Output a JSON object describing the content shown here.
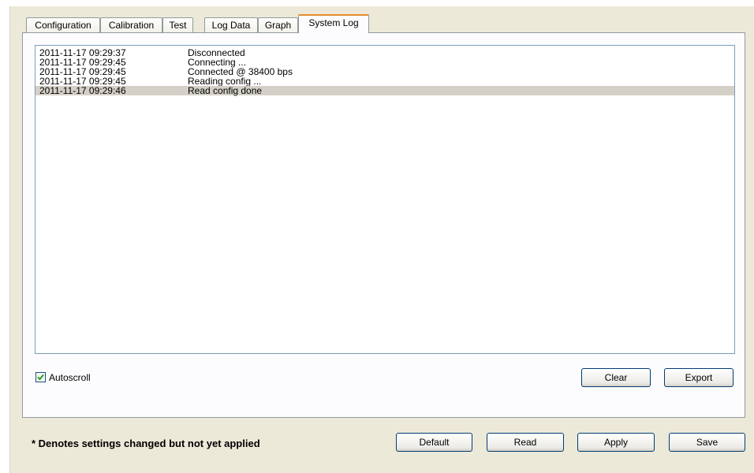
{
  "tabs": [
    {
      "label": "Configuration"
    },
    {
      "label": "Calibration"
    },
    {
      "label": "Test"
    },
    {
      "label": "Log Data"
    },
    {
      "label": "Graph"
    },
    {
      "label": "System Log"
    }
  ],
  "active_tab": "System Log",
  "log": {
    "entries": [
      {
        "time": "2011-11-17 09:29:37",
        "message": "Disconnected"
      },
      {
        "time": "2011-11-17 09:29:45",
        "message": "Connecting ..."
      },
      {
        "time": "2011-11-17 09:29:45",
        "message": "Connected @ 38400 bps"
      },
      {
        "time": "2011-11-17 09:29:45",
        "message": "Reading config ..."
      },
      {
        "time": "2011-11-17 09:29:46",
        "message": "Read config done"
      }
    ],
    "selected_entry": 4
  },
  "autoscroll": {
    "label": "Autoscroll",
    "checked": true
  },
  "log_actions": {
    "clear_label": "Clear",
    "export_label": "Export"
  },
  "footer": {
    "note": "* Denotes settings changed but not yet applied",
    "default_label": "Default",
    "read_label": "Read",
    "apply_label": "Apply",
    "save_label": "Save"
  },
  "colors": {
    "window_bg": "#ece9d8",
    "active_tab_accent": "#e68b2c",
    "selection_bg": "#d4d0c8",
    "button_border": "#003c74",
    "checkmark": "#21a121"
  }
}
